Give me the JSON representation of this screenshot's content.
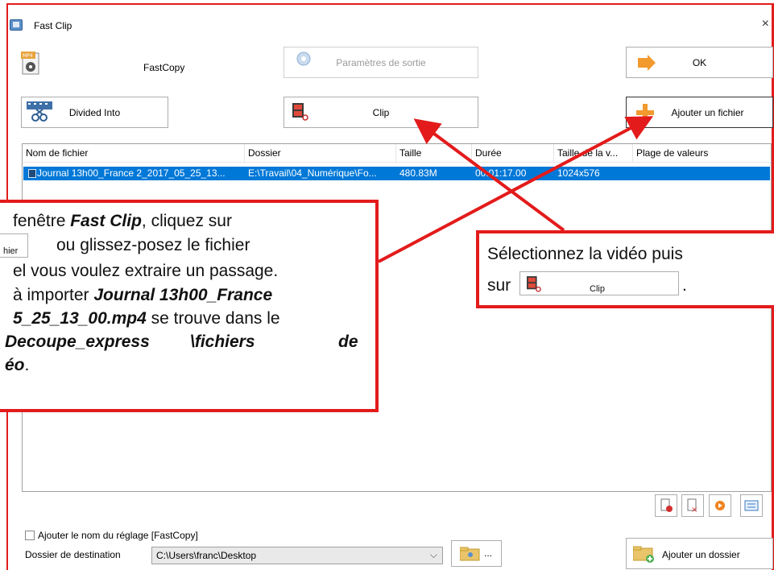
{
  "window": {
    "title": "Fast Clip",
    "close_glyph": "×"
  },
  "toolbar": {
    "format_label": "FastCopy",
    "format_icon_badge": "MP4",
    "output_settings_label": "Paramètres de sortie",
    "ok_label": "OK",
    "divided_into_label": "Divided Into",
    "clip_label": "Clip",
    "add_file_label": "Ajouter un fichier"
  },
  "file_list": {
    "columns": [
      "Nom de fichier",
      "Dossier",
      "Taille",
      "Durée",
      "Taille de la v...",
      "Plage de valeurs"
    ],
    "rows": [
      {
        "name": "Journal 13h00_France 2_2017_05_25_13...",
        "folder": "E:\\Travail\\04_Numérique\\Fo...",
        "size": "480.83M",
        "duration": "00:01:17.00",
        "video_size": "1024x576",
        "range": ""
      }
    ]
  },
  "callout_left": {
    "line1_a": "fenêtre ",
    "line1_b": "Fast Clip",
    "line1_c": ", cliquez sur",
    "line2_chip": "hier",
    "line2_text": "ou glissez-posez le fichier",
    "line3": "el vous voulez extraire un passage.",
    "line4_a": "à importer ",
    "line4_b": "Journal 13h00_France",
    "line5_a": "5_25_13_00.mp4",
    "line5_b": " se trouve dans le",
    "line6_a": "Decoupe_express",
    "line6_b": "\\fichiers",
    "line6_c": "de",
    "line7_a": "éo",
    "line7_b": "."
  },
  "callout_right": {
    "line1": "Sélectionnez la vidéo puis",
    "line2_a": "sur",
    "line2_chip": "Clip",
    "line2_b": "."
  },
  "options": {
    "add_preset_name_label": "Ajouter le nom du réglage [FastCopy]",
    "add_preset_name_checked": false
  },
  "destination": {
    "label": "Dossier de destination",
    "path": "C:\\Users\\franc\\Desktop",
    "browse_label": "...",
    "add_folder_label": "Ajouter un dossier"
  },
  "colors": {
    "accent_red": "#e31b1b",
    "selection_blue": "#0078d7"
  }
}
